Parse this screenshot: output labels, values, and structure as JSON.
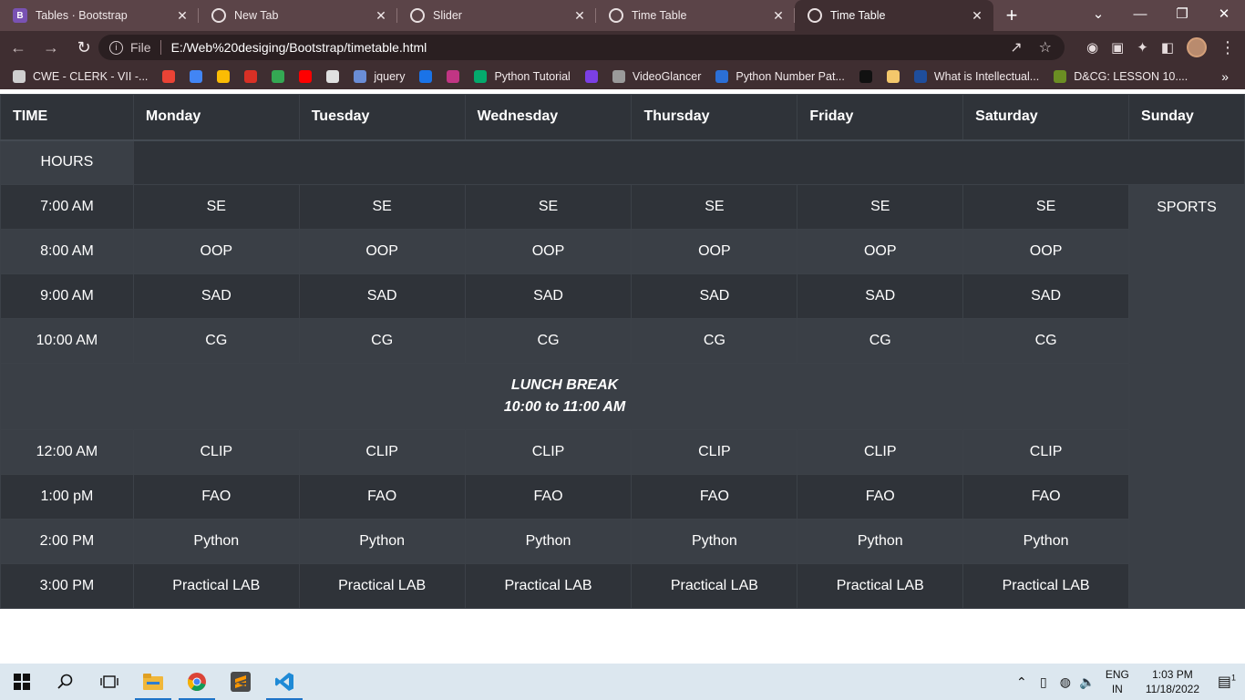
{
  "browser": {
    "tabs": [
      {
        "title": "Tables · Bootstrap",
        "favicon": "bootstrap-icon",
        "active": false
      },
      {
        "title": "New Tab",
        "favicon": "chrome-icon",
        "active": false
      },
      {
        "title": "Slider",
        "favicon": "globe-icon",
        "active": false
      },
      {
        "title": "Time Table",
        "favicon": "globe-icon",
        "active": false
      },
      {
        "title": "Time Table",
        "favicon": "globe-icon",
        "active": true
      }
    ],
    "address": {
      "scheme_label": "File",
      "url": "E:/Web%20desiging/Bootstrap/timetable.html"
    },
    "bookmarks": [
      {
        "label": "CWE - CLERK - VII -...",
        "color": "#cfcfcf"
      },
      {
        "label": "",
        "color": "#ea4335"
      },
      {
        "label": "",
        "color": "#4285f4"
      },
      {
        "label": "",
        "color": "#fbbc04"
      },
      {
        "label": "",
        "color": "#d93025"
      },
      {
        "label": "",
        "color": "#34a853"
      },
      {
        "label": "",
        "color": "#ff0000"
      },
      {
        "label": "",
        "color": "#e0e0e0"
      },
      {
        "label": "jquery",
        "color": "#6a8dd6"
      },
      {
        "label": "",
        "color": "#1a73e8"
      },
      {
        "label": "",
        "color": "#c13584"
      },
      {
        "label": "Python Tutorial",
        "color": "#04aa6d"
      },
      {
        "label": "",
        "color": "#7b3fe4"
      },
      {
        "label": "VideoGlancer",
        "color": "#9a9a9a"
      },
      {
        "label": "Python Number Pat...",
        "color": "#2b6fd6"
      },
      {
        "label": "",
        "color": "#111111"
      },
      {
        "label": "",
        "color": "#f3c76b"
      },
      {
        "label": "What is Intellectual...",
        "color": "#1f4e9c"
      },
      {
        "label": "D&CG: LESSON 10....",
        "color": "#6b8e23"
      }
    ]
  },
  "timetable": {
    "headers": [
      "TIME",
      "Monday",
      "Tuesday",
      "Wednesday",
      "Thursday",
      "Friday",
      "Saturday",
      "Sunday"
    ],
    "hours_label": "HOURS",
    "sunday_activity": "SPORTS",
    "rows_before_lunch": [
      {
        "time": "7:00 AM",
        "subject": "SE"
      },
      {
        "time": "8:00 AM",
        "subject": "OOP"
      },
      {
        "time": "9:00 AM",
        "subject": "SAD"
      },
      {
        "time": "10:00 AM",
        "subject": "CG"
      }
    ],
    "lunch": {
      "title": "LUNCH BREAK",
      "time": "10:00 to 11:00 AM"
    },
    "rows_after_lunch": [
      {
        "time": "12:00 AM",
        "subject": "CLIP"
      },
      {
        "time": "1:00 pM",
        "subject": "FAO"
      },
      {
        "time": "2:00 PM",
        "subject": "Python"
      },
      {
        "time": "3:00 PM",
        "subject": "Practical LAB"
      }
    ]
  },
  "taskbar": {
    "language": "ENG",
    "region": "IN",
    "time": "1:03 PM",
    "date": "11/18/2022",
    "notification_count": "1"
  }
}
